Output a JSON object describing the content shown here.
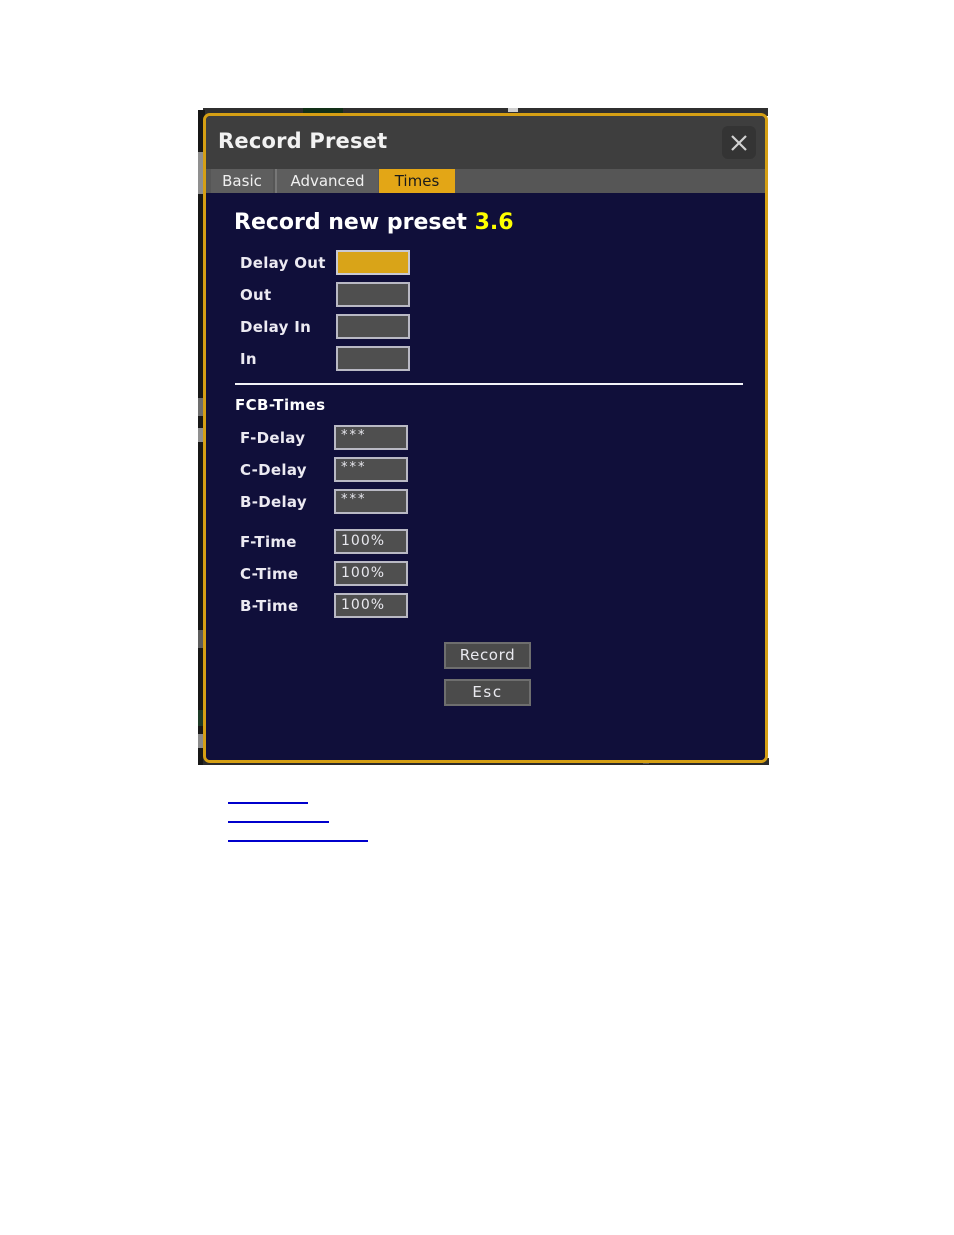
{
  "window": {
    "title": "Record Preset",
    "close_icon": "close-icon",
    "border_color": "#d59f14",
    "titlebar_color": "#3e3e3e",
    "body_color": "#100f3a"
  },
  "tabs": [
    {
      "label": "Basic",
      "active": false
    },
    {
      "label": "Advanced",
      "active": false
    },
    {
      "label": "Times",
      "active": true
    }
  ],
  "content": {
    "heading_text": "Record new preset",
    "heading_version": "3.6",
    "heading_version_color": "#ffff00",
    "accent_color": "#e3a616",
    "focus_color": "#d9a418"
  },
  "timing_fields": [
    {
      "label": "Delay Out",
      "value": "",
      "focused": true
    },
    {
      "label": "Out",
      "value": "",
      "focused": false
    },
    {
      "label": "Delay In",
      "value": "",
      "focused": false
    },
    {
      "label": "In",
      "value": "",
      "focused": false
    }
  ],
  "fcb": {
    "section_title": "FCB-Times",
    "delay_fields": [
      {
        "label": "F-Delay",
        "value": "***"
      },
      {
        "label": "C-Delay",
        "value": "***"
      },
      {
        "label": "B-Delay",
        "value": "***"
      }
    ],
    "time_fields": [
      {
        "label": "F-Time",
        "value": "100%"
      },
      {
        "label": "C-Time",
        "value": "100%"
      },
      {
        "label": "B-Time",
        "value": "100%"
      }
    ]
  },
  "buttons": {
    "record": "Record",
    "esc": "Esc"
  },
  "doc_links": [
    {
      "text": ""
    },
    {
      "text": ""
    },
    {
      "text": ""
    }
  ]
}
